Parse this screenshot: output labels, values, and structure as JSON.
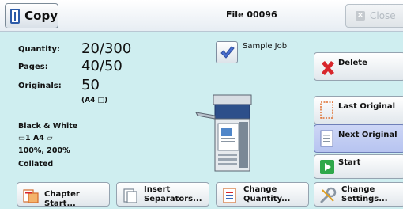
{
  "header": {
    "tab_label": "Copy",
    "file_title": "File 00096",
    "close_label": "Close"
  },
  "info": {
    "quantity_key": "Quantity:",
    "quantity_val": "20/300",
    "pages_key": "Pages:",
    "pages_val": "40/50",
    "originals_key": "Originals:",
    "originals_val": "50",
    "originals_size": "(A4 □)"
  },
  "settings": {
    "color": "Black & White",
    "tray": "▭1   A4 ▱",
    "zoom": "100%, 200%",
    "finish": "Collated"
  },
  "sample_job_label": "Sample Job",
  "right_buttons": {
    "delete": "Delete",
    "last_original": "Last Original",
    "next_original": "Next Original",
    "start": "Start"
  },
  "bottom_buttons": {
    "chapter_start": "Chapter Start...",
    "insert_line1": "Insert",
    "insert_line2": "Separators...",
    "change_qty_line1": "Change",
    "change_qty_line2": "Quantity...",
    "change_set_line1": "Change",
    "change_set_line2": "Settings..."
  },
  "colors": {
    "background": "#cfeef0",
    "selected_button": "#c3cdf3",
    "delete_red": "#d8262c",
    "start_green": "#2fa84a"
  }
}
